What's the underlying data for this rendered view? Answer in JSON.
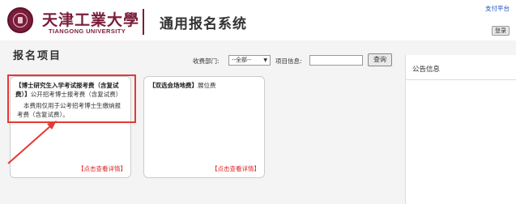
{
  "header": {
    "university_cn": "天津工業大學",
    "university_en": "TIANGONG UNIVERSITY",
    "site_title": "通用报名系统",
    "pay_platform_link": "支付平台",
    "login_button": "登录"
  },
  "main": {
    "section_title": "报名项目",
    "filter": {
      "dept_label": "收费部门:",
      "dept_selected": "--全部--",
      "item_label": "项目信息:",
      "item_value": "",
      "query_button": "查询"
    },
    "notice": {
      "title": "公告信息"
    },
    "cards": [
      {
        "tag": "【博士研究生入学考试报考费（含复试费）】",
        "title": "公开招考博士报考费（含复试费）",
        "desc": "本费用仅用于公考招考博士生缴纳报考费（含复试费）。",
        "link": "【点击查看详情】"
      },
      {
        "tag": "【双选会场地费】",
        "title": "展位费",
        "desc": "",
        "link": "【点击查看详情】"
      }
    ]
  },
  "colors": {
    "brand": "#7a1d3a",
    "link": "#1a4fbf",
    "highlight": "#e53935",
    "detail_link": "#e02020"
  }
}
